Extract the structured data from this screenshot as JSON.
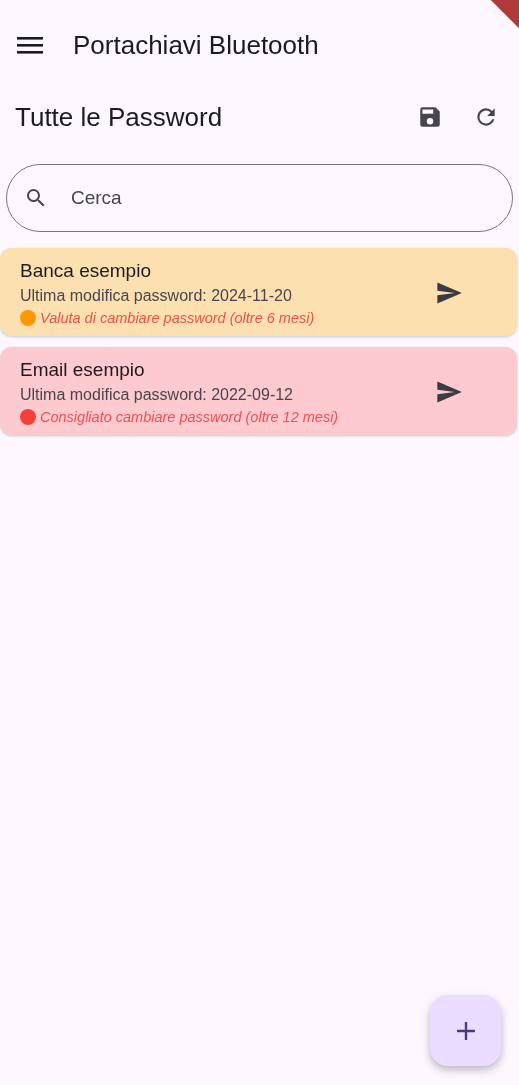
{
  "app_bar": {
    "title": "Portachiavi Bluetooth"
  },
  "header": {
    "title": "Tutte le Password"
  },
  "search": {
    "placeholder": "Cerca"
  },
  "entries": [
    {
      "name": "Banca esempio",
      "last_change": "Ultima modifica password: 2024-11-20",
      "warning": "Valuta di cambiare password (oltre 6 mesi)",
      "kind": "warning",
      "color": "#ff9800"
    },
    {
      "name": "Email esempio",
      "last_change": "Ultima modifica password: 2022-09-12",
      "warning": "Consigliato cambiare password (oltre 12 mesi)",
      "kind": "danger",
      "color": "#f44336"
    }
  ]
}
